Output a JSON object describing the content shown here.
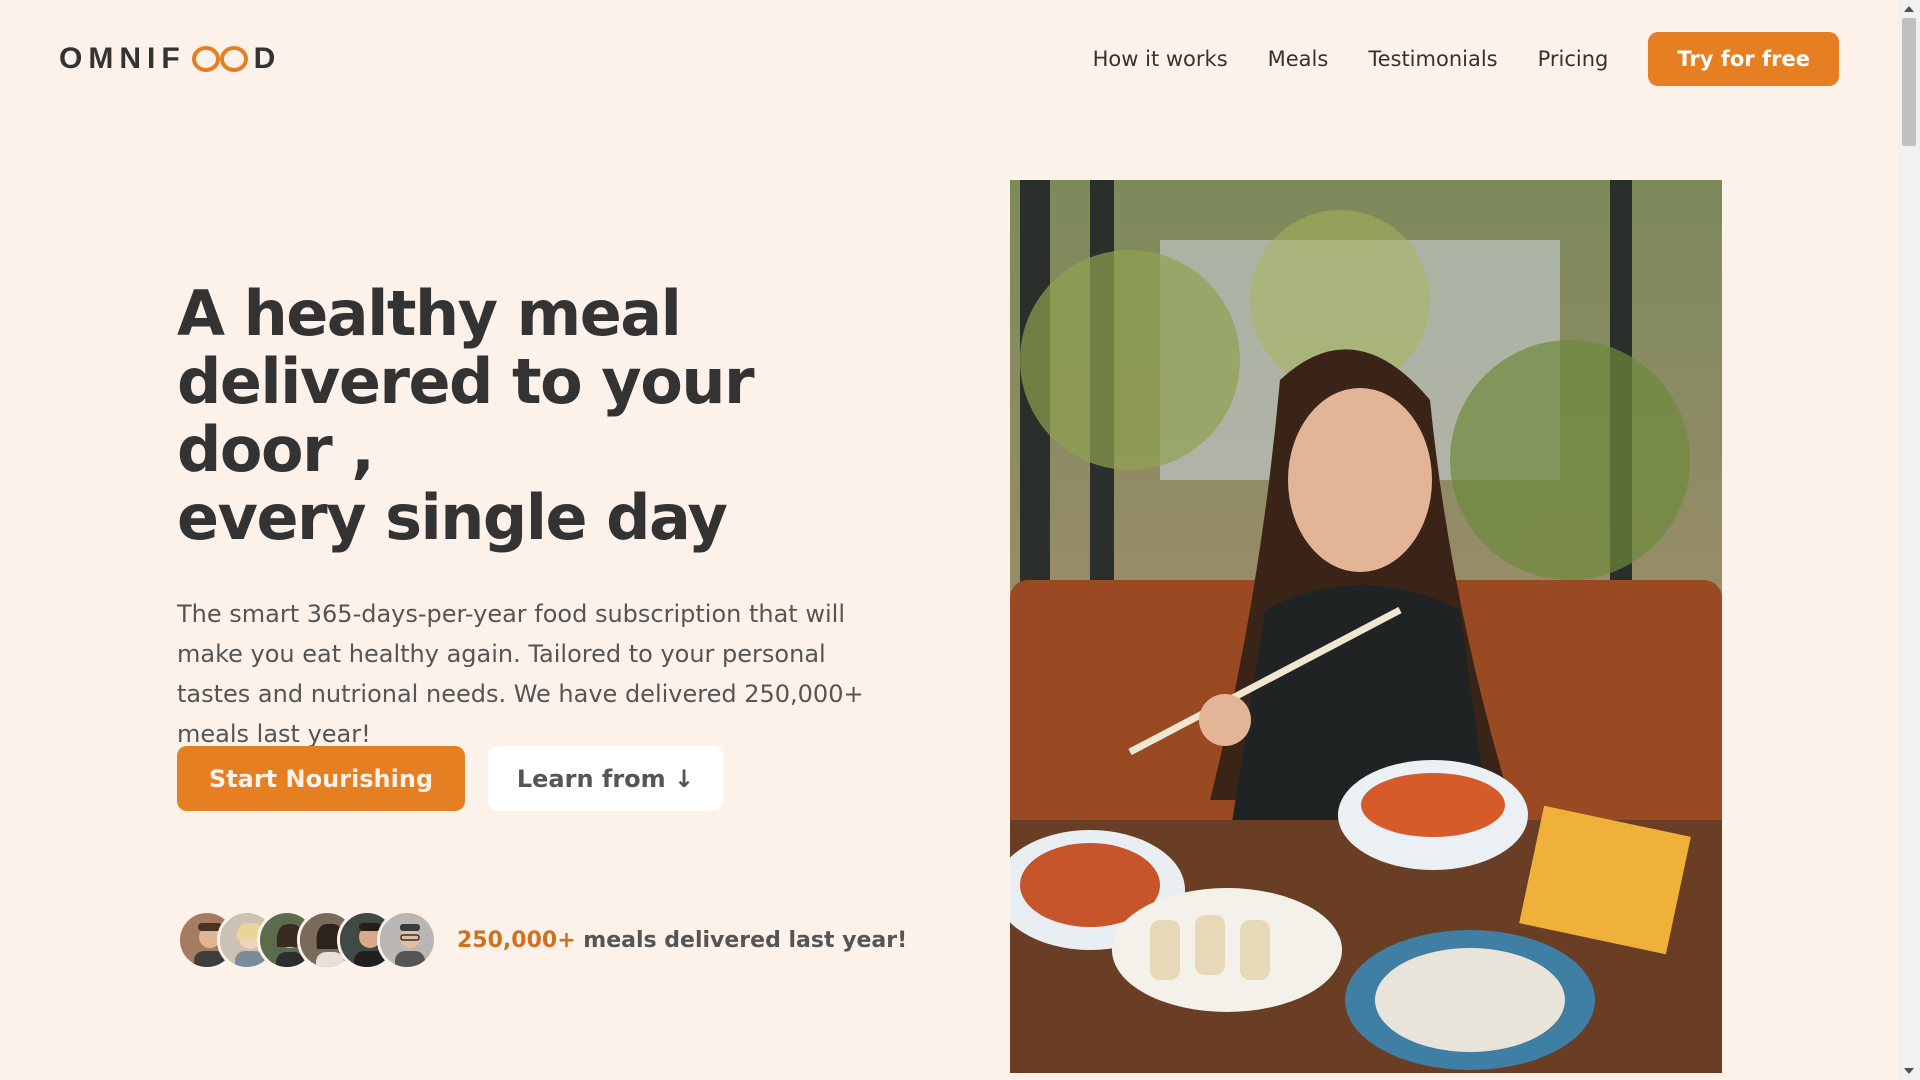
{
  "brand": {
    "name_left": "OMNIF",
    "name_right": "D",
    "accent": "#e67e22"
  },
  "nav": {
    "items": [
      "How it works",
      "Meals",
      "Testimonials",
      "Pricing"
    ],
    "cta": "Try for free"
  },
  "hero": {
    "title_line1": "A healthy meal",
    "title_line2": "delivered to your door ,",
    "title_line3": "every single day",
    "description": "The smart 365-days-per-year food subscription that will make you eat healthy again. Tailored to your personal tastes and nutrional needs. We have delivered 250,000+ meals last year!",
    "primary_button": "Start Nourishing",
    "secondary_button": "Learn from ↓"
  },
  "delivered": {
    "count": "250,000+",
    "text": " meals delivered last year!"
  },
  "colors": {
    "background": "#fdf2e9",
    "primary": "#e67e22",
    "number": "#cf711f"
  }
}
